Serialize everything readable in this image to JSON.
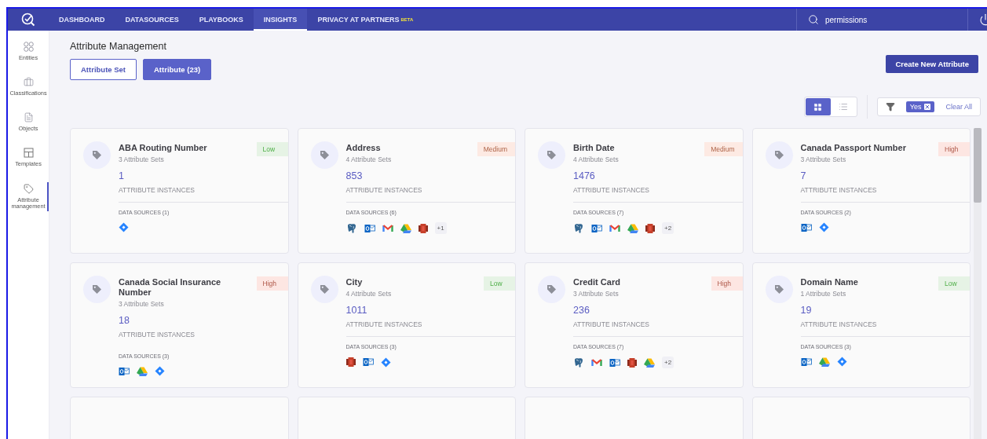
{
  "nav": {
    "items": [
      {
        "label": "DASHBOARD",
        "selected": false
      },
      {
        "label": "DATASOURCES",
        "selected": false
      },
      {
        "label": "PLAYBOOKS",
        "selected": false
      },
      {
        "label": "INSIGHTS",
        "selected": true
      },
      {
        "label": "PRIVACY AT PARTNERS",
        "badge": "BETA",
        "selected": false
      }
    ],
    "search": {
      "value": "permissions"
    }
  },
  "sidebar": {
    "items": [
      {
        "kind": "entities",
        "label": "Entities",
        "selected": false
      },
      {
        "kind": "classifications",
        "label": "Classifications",
        "selected": false
      },
      {
        "kind": "objects",
        "label": "Objects",
        "selected": false
      },
      {
        "kind": "templates",
        "label": "Templates",
        "selected": false
      },
      {
        "kind": "attributes",
        "label": "Attribute management",
        "selected": true
      }
    ]
  },
  "page": {
    "title": "Attribute Management",
    "tabs": [
      {
        "label": "Attribute Set",
        "selected": false
      },
      {
        "label": "Attribute (23)",
        "selected": true
      }
    ],
    "create_button": "Create New Attribute"
  },
  "toolbar": {
    "views": [
      {
        "kind": "grid",
        "selected": true
      },
      {
        "kind": "list",
        "selected": false
      }
    ],
    "filter_chips": [
      "Yes"
    ],
    "clear": "Clear All"
  },
  "attributes": [
    {
      "kind": "card",
      "name": "ABA Routing Number",
      "sets": "3 Attribute Sets",
      "count": "1",
      "count_label": "ATTRIBUTE INSTANCES",
      "risk": "Low",
      "color": "#e6f3e5",
      "sources_label": "DATA SOURCES (1)",
      "sources": [
        {
          "kind": "jira"
        }
      ]
    },
    {
      "kind": "card",
      "name": "Address",
      "sets": "4 Attribute Sets",
      "count": "853",
      "count_label": "ATTRIBUTE INSTANCES",
      "risk": "Medium",
      "color": "#fdeae3",
      "sources_label": "DATA SOURCES (6)",
      "sources": [
        {
          "kind": "postgres"
        },
        {
          "kind": "outlook"
        },
        {
          "kind": "gmail"
        },
        {
          "kind": "drive"
        },
        {
          "kind": "s3"
        }
      ],
      "more": "+1"
    },
    {
      "kind": "card",
      "name": "Birth Date",
      "sets": "4 Attribute Sets",
      "count": "1476",
      "count_label": "ATTRIBUTE INSTANCES",
      "risk": "Medium",
      "color": "#fdeae3",
      "sources_label": "DATA SOURCES (7)",
      "sources": [
        {
          "kind": "postgres"
        },
        {
          "kind": "outlook"
        },
        {
          "kind": "gmail"
        },
        {
          "kind": "drive"
        },
        {
          "kind": "s3"
        }
      ],
      "more": "+2"
    },
    {
      "kind": "card",
      "name": "Canada Passport Number",
      "sets": "3 Attribute Sets",
      "count": "7",
      "count_label": "ATTRIBUTE INSTANCES",
      "risk": "High",
      "color": "#fde6e2",
      "sources_label": "DATA SOURCES (2)",
      "sources": [
        {
          "kind": "outlook"
        },
        {
          "kind": "jira"
        }
      ]
    },
    {
      "kind": "card",
      "name": "Canada Social Insurance Number",
      "sets": "3 Attribute Sets",
      "count": "18",
      "count_label": "ATTRIBUTE INSTANCES",
      "risk": "High",
      "color": "#fde6e2",
      "sources_label": "DATA SOURCES (3)",
      "sources": [
        {
          "kind": "outlook"
        },
        {
          "kind": "drive"
        },
        {
          "kind": "jira"
        }
      ]
    },
    {
      "kind": "card",
      "name": "City",
      "sets": "4 Attribute Sets",
      "count": "1011",
      "count_label": "ATTRIBUTE INSTANCES",
      "risk": "Low",
      "color": "#e6f3e5",
      "sources_label": "DATA SOURCES (3)",
      "sources": [
        {
          "kind": "s3"
        },
        {
          "kind": "outlook"
        },
        {
          "kind": "jira"
        }
      ]
    },
    {
      "kind": "card",
      "name": "Credit Card",
      "sets": "3 Attribute Sets",
      "count": "236",
      "count_label": "ATTRIBUTE INSTANCES",
      "risk": "High",
      "color": "#fde6e2",
      "sources_label": "DATA SOURCES (7)",
      "sources": [
        {
          "kind": "postgres"
        },
        {
          "kind": "gmail"
        },
        {
          "kind": "outlook"
        },
        {
          "kind": "s3"
        },
        {
          "kind": "drive"
        }
      ],
      "more": "+2"
    },
    {
      "kind": "card",
      "name": "Domain Name",
      "sets": "1 Attribute Sets",
      "count": "19",
      "count_label": "ATTRIBUTE INSTANCES",
      "risk": "Low",
      "color": "#e6f3e5",
      "sources_label": "DATA SOURCES (3)",
      "sources": [
        {
          "kind": "outlook"
        },
        {
          "kind": "drive"
        },
        {
          "kind": "jira"
        }
      ]
    },
    {
      "kind": "stub"
    },
    {
      "kind": "stub"
    },
    {
      "kind": "stub"
    },
    {
      "kind": "stub"
    }
  ]
}
